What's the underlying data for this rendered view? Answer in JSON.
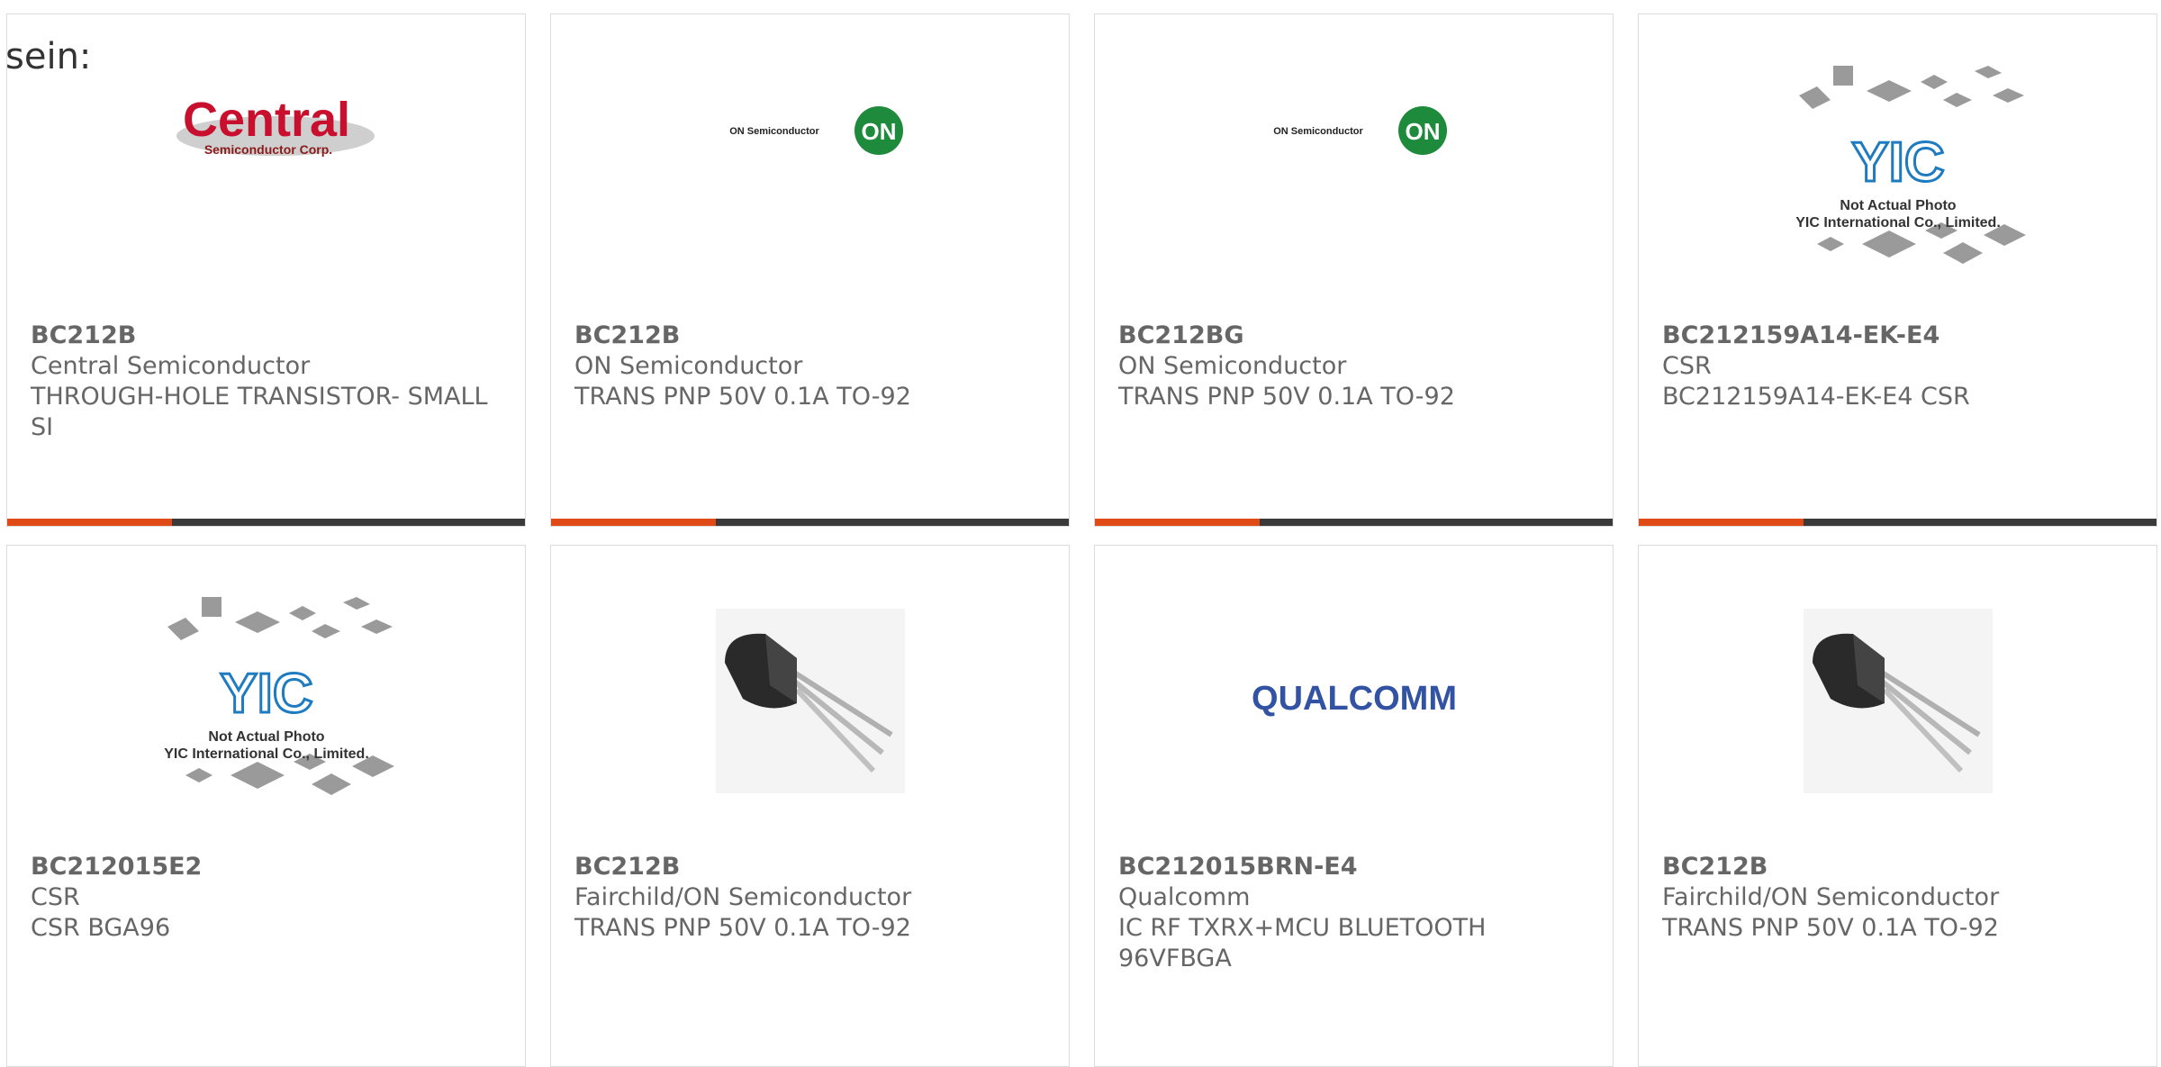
{
  "intro_text": "sein:",
  "products": [
    {
      "part": "BC212B",
      "manufacturer": "Central Semiconductor",
      "description": "THROUGH-HOLE TRANSISTOR- SMALL SI",
      "image": "central-semiconductor-logo"
    },
    {
      "part": "BC212B",
      "manufacturer": "ON Semiconductor",
      "description": "TRANS PNP 50V 0.1A TO-92",
      "image": "on-semiconductor-logo"
    },
    {
      "part": "BC212BG",
      "manufacturer": "ON Semiconductor",
      "description": "TRANS PNP 50V 0.1A TO-92",
      "image": "on-semiconductor-logo"
    },
    {
      "part": "BC212159A14-EK-E4",
      "manufacturer": "CSR",
      "description": "BC212159A14-EK-E4 CSR",
      "image": "yic-placeholder"
    },
    {
      "part": "BC212015E2",
      "manufacturer": "CSR",
      "description": "CSR BGA96",
      "image": "yic-placeholder"
    },
    {
      "part": "BC212B",
      "manufacturer": "Fairchild/ON Semiconductor",
      "description": "TRANS PNP 50V 0.1A TO-92",
      "image": "to92-transistor-photo"
    },
    {
      "part": "BC212015BRN-E4",
      "manufacturer": "Qualcomm",
      "description": "IC RF TXRX+MCU BLUETOOTH 96VFBGA",
      "image": "qualcomm-logo"
    },
    {
      "part": "BC212B",
      "manufacturer": "Fairchild/ON Semiconductor",
      "description": "TRANS PNP 50V 0.1A TO-92",
      "image": "to92-transistor-photo"
    }
  ],
  "logos": {
    "central_main": "Central",
    "central_sub": "Semiconductor Corp.",
    "on_semi_text": "ON Semiconductor",
    "on_mark": "ON",
    "yic_mark": "YIC",
    "yic_line1": "Not Actual Photo",
    "yic_line2": "YIC International Co., Limited.",
    "qualcomm": "QUALCOMM"
  },
  "colors": {
    "accent": "#e04a17",
    "bar": "#3a3a3a",
    "central_red": "#c8102e",
    "on_green": "#1e8a3c",
    "qualcomm_blue": "#3253a3",
    "yic_blue": "#1f7bc0"
  }
}
